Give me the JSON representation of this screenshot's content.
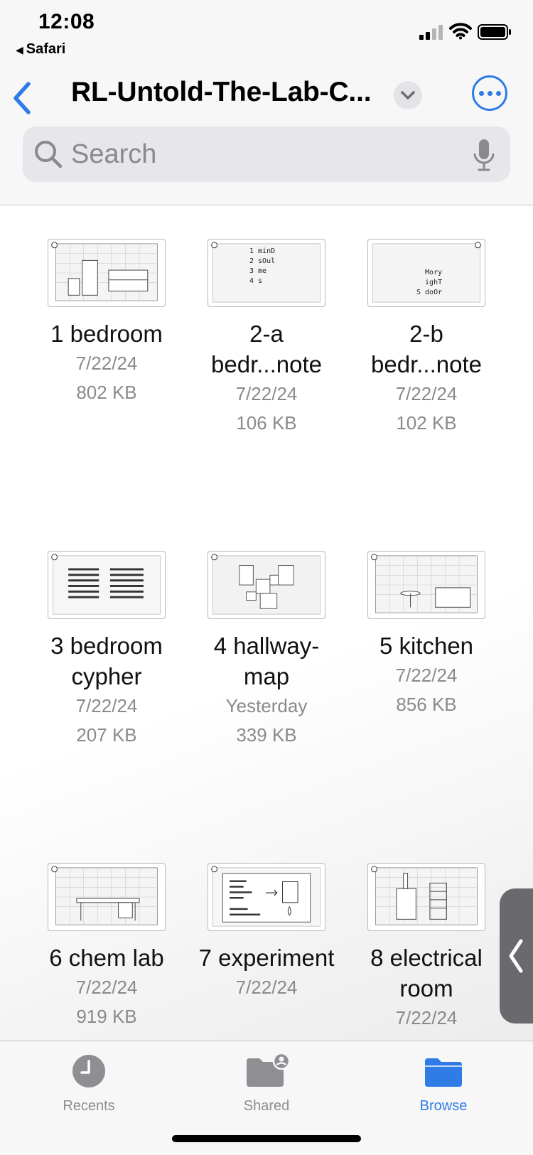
{
  "status_bar": {
    "time": "12:08",
    "back_app": "Safari"
  },
  "nav": {
    "title": "RL-Untold-The-Lab-C...",
    "back_icon": "chevron-left-icon",
    "menu_icon": "chevron-down-icon",
    "more_icon": "ellipsis-icon",
    "accent_color": "#2f7ce6"
  },
  "search": {
    "placeholder": "Search"
  },
  "files": [
    {
      "name": "1 bedroom",
      "date": "7/22/24",
      "size": "802 KB",
      "thumb_text": ""
    },
    {
      "name": "2-a bedr...note",
      "date": "7/22/24",
      "size": "106 KB",
      "thumb_text": "1 minD\n2 sOul\n3 me\n4 s"
    },
    {
      "name": "2-b bedr...note",
      "date": "7/22/24",
      "size": "102 KB",
      "thumb_text": "Mory\nighT\nS doOr"
    },
    {
      "name": "3 bedroom cypher",
      "date": "7/22/24",
      "size": "207 KB",
      "thumb_text": ""
    },
    {
      "name": "4 hallway-map",
      "date": "Yesterday",
      "size": "339 KB",
      "thumb_text": ""
    },
    {
      "name": "5 kitchen",
      "date": "7/22/24",
      "size": "856 KB",
      "thumb_text": ""
    },
    {
      "name": "6 chem lab",
      "date": "7/22/24",
      "size": "919 KB",
      "thumb_text": ""
    },
    {
      "name": "7 experiment",
      "date": "7/22/24",
      "size": "",
      "thumb_text": ""
    },
    {
      "name": "8 electrical room",
      "date": "7/22/24",
      "size": "",
      "thumb_text": ""
    }
  ],
  "tabs": [
    {
      "label": "Recents",
      "icon": "clock-icon",
      "active": false
    },
    {
      "label": "Shared",
      "icon": "shared-folder-icon",
      "active": false
    },
    {
      "label": "Browse",
      "icon": "folder-icon",
      "active": true
    }
  ]
}
